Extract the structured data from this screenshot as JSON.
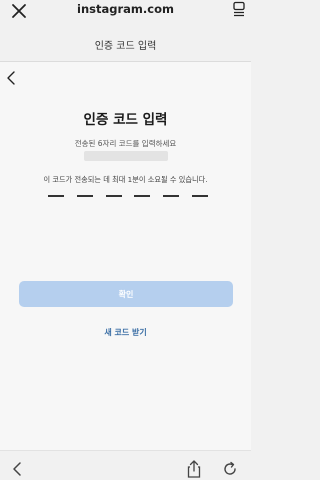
{
  "browser": {
    "url": "instagram.com",
    "page_title": "인증 코드 입력",
    "icons": [
      "close-icon",
      "menu-icon"
    ]
  },
  "main": {
    "heading": "인증 코드 입력",
    "subtitle": "전송된 6자리 코드를 입력하세요",
    "notice": "이 코드가 전송되는 데 최대 1분이 소요될 수 있습니다.",
    "code_slots": [
      "",
      "",
      "",
      "",
      "",
      ""
    ],
    "confirm_label": "확인",
    "resend_label": "새 코드 받기"
  },
  "bottom_bar": {
    "icons": [
      "back-arrow-icon",
      "share-icon",
      "refresh-icon"
    ]
  },
  "colors": {
    "confirm_button": "#b5cfee",
    "link": "#3a6ea5"
  }
}
